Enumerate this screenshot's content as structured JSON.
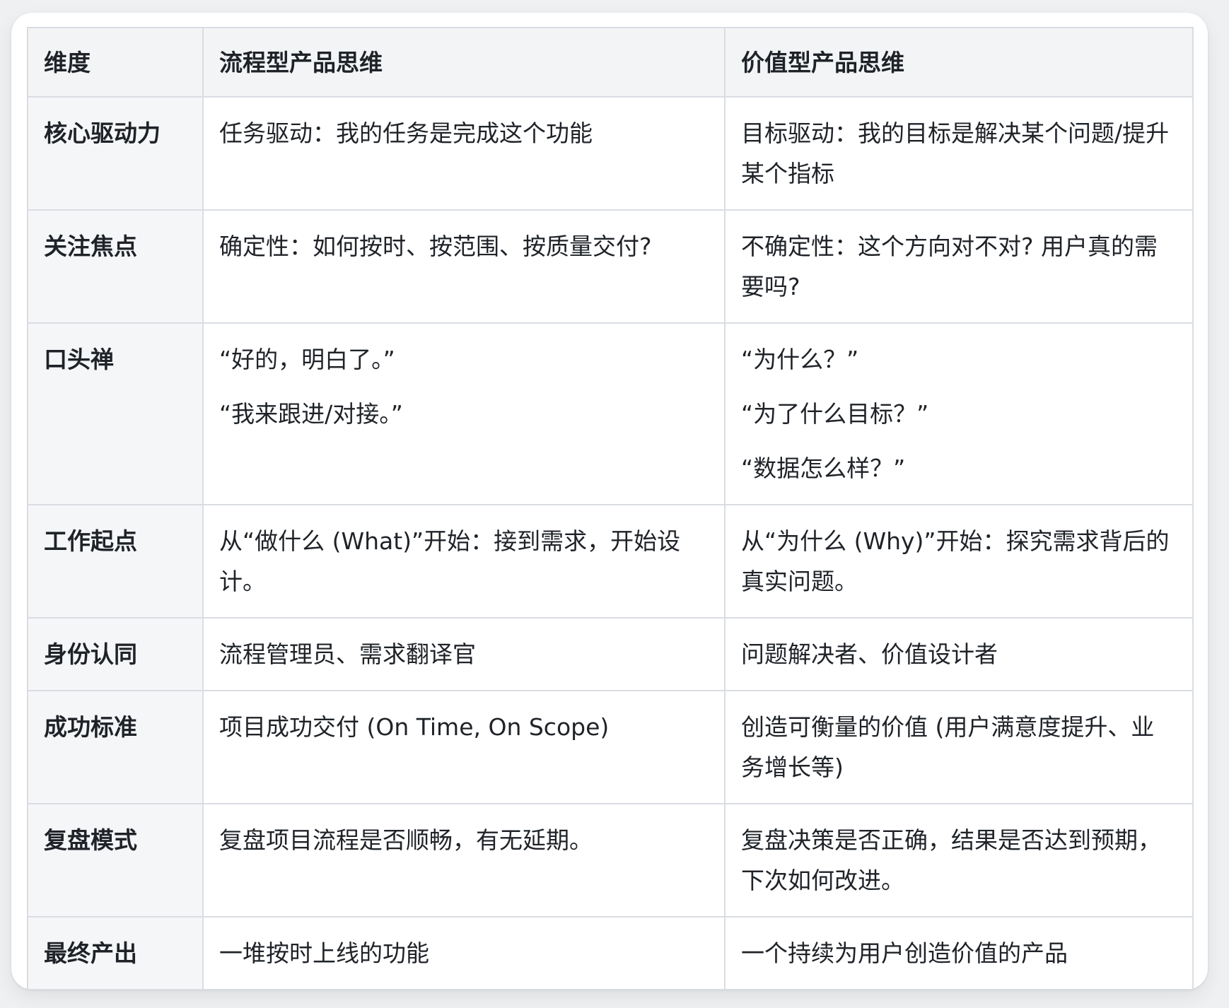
{
  "table": {
    "headers": [
      "维度",
      "流程型产品思维",
      "价值型产品思维"
    ],
    "rows": [
      {
        "dimension": "核心驱动力",
        "process": [
          "任务驱动：我的任务是完成这个功能"
        ],
        "value": [
          "目标驱动：我的目标是解决某个问题/提升某个指标"
        ]
      },
      {
        "dimension": "关注焦点",
        "process": [
          "确定性：如何按时、按范围、按质量交付?"
        ],
        "value": [
          "不确定性：这个方向对不对? 用户真的需要吗?"
        ]
      },
      {
        "dimension": "口头禅",
        "process": [
          "“好的，明白了。”",
          "“我来跟进/对接。”"
        ],
        "value": [
          "“为什么？”",
          "“为了什么目标？”",
          "“数据怎么样？”"
        ]
      },
      {
        "dimension": "工作起点",
        "process": [
          "从“做什么 (What)”开始：接到需求，开始设计。"
        ],
        "value": [
          "从“为什么 (Why)”开始：探究需求背后的真实问题。"
        ]
      },
      {
        "dimension": "身份认同",
        "process": [
          "流程管理员、需求翻译官"
        ],
        "value": [
          "问题解决者、价值设计者"
        ]
      },
      {
        "dimension": "成功标准",
        "process": [
          "项目成功交付 (On Time, On Scope)"
        ],
        "value": [
          "创造可衡量的价值 (用户满意度提升、业务增长等)"
        ]
      },
      {
        "dimension": "复盘模式",
        "process": [
          "复盘项目流程是否顺畅，有无延期。"
        ],
        "value": [
          "复盘决策是否正确，结果是否达到预期，下次如何改进。"
        ]
      },
      {
        "dimension": "最终产出",
        "process": [
          "一堆按时上线的功能"
        ],
        "value": [
          "一个持续为用户创造价值的产品"
        ]
      }
    ]
  }
}
